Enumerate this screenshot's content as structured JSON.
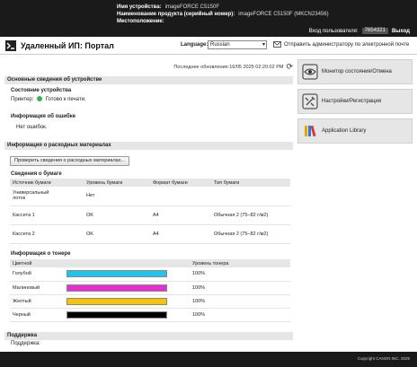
{
  "device": {
    "name_label": "Имя устройства:",
    "name_value": "imageFORCE C5150F",
    "product_label": "Наименование продукта (серийный номер):",
    "product_value": "imageFORCE C5150F (MKCN23456)",
    "location_label": "Местоположение:",
    "location_value": ""
  },
  "login": {
    "user_label": "Вход пользователя:",
    "user_value": "7654321",
    "logout": "Выход"
  },
  "header": {
    "title": "Удаленный ИП: Портал",
    "language_label": "Language:",
    "language_value": "Russian",
    "mail_link": "Отправить администратору по электронной почте"
  },
  "updated": "Последнее обновление:16/05 2025 02:20:02 PM",
  "sections": {
    "basic": "Основные сведения об устройстве",
    "device_status": "Состояние устройства",
    "printer_label": "Принтер:",
    "printer_status": "Готово к печати.",
    "error_info": "Информация об ошибке",
    "no_errors": "Нет ошибок.",
    "consumables": "Информация о расходных материалах",
    "check_button": "Проверить сведения о расходных материалах...",
    "paper_info": "Сведения о бумаге",
    "toner_info": "Информация о тонере",
    "support": "Поддержка",
    "support_label": "Поддержка:"
  },
  "paper_table": {
    "headers": [
      "Источник бумаги",
      "Уровень бумаги",
      "Формат бумаги",
      "Тип бумаги"
    ],
    "rows": [
      [
        "Универсальный лоток",
        "Нет",
        "",
        ""
      ],
      [
        "Кассета 1",
        "OK",
        "A4",
        "Обычная 2 (75–82 г/м2)"
      ],
      [
        "Кассета 2",
        "OK",
        "A4",
        "Обычная 2 (75–82 г/м2)"
      ]
    ]
  },
  "toner_table": {
    "headers": [
      "Цветной",
      "",
      "Уровень тонера"
    ],
    "rows": [
      {
        "name": "Голубой",
        "color": "#21c3ea",
        "level": "100%",
        "fraction": 1.0
      },
      {
        "name": "Малиновый",
        "color": "#e62fd0",
        "level": "100%",
        "fraction": 1.0
      },
      {
        "name": "Желтый",
        "color": "#f6c500",
        "level": "100%",
        "fraction": 1.0
      },
      {
        "name": "Черный",
        "color": "#000000",
        "level": "100%",
        "fraction": 1.0
      }
    ]
  },
  "sidebar": {
    "items": [
      {
        "label": "Монитор состояния/Отмена",
        "icon": "eye-icon"
      },
      {
        "label": "Настройки/Регистрация",
        "icon": "settings-icon"
      },
      {
        "label": "Application Library",
        "icon": "app-library-icon"
      }
    ]
  },
  "footer": {
    "copyright": "Copyright CANON INC. 2025"
  }
}
